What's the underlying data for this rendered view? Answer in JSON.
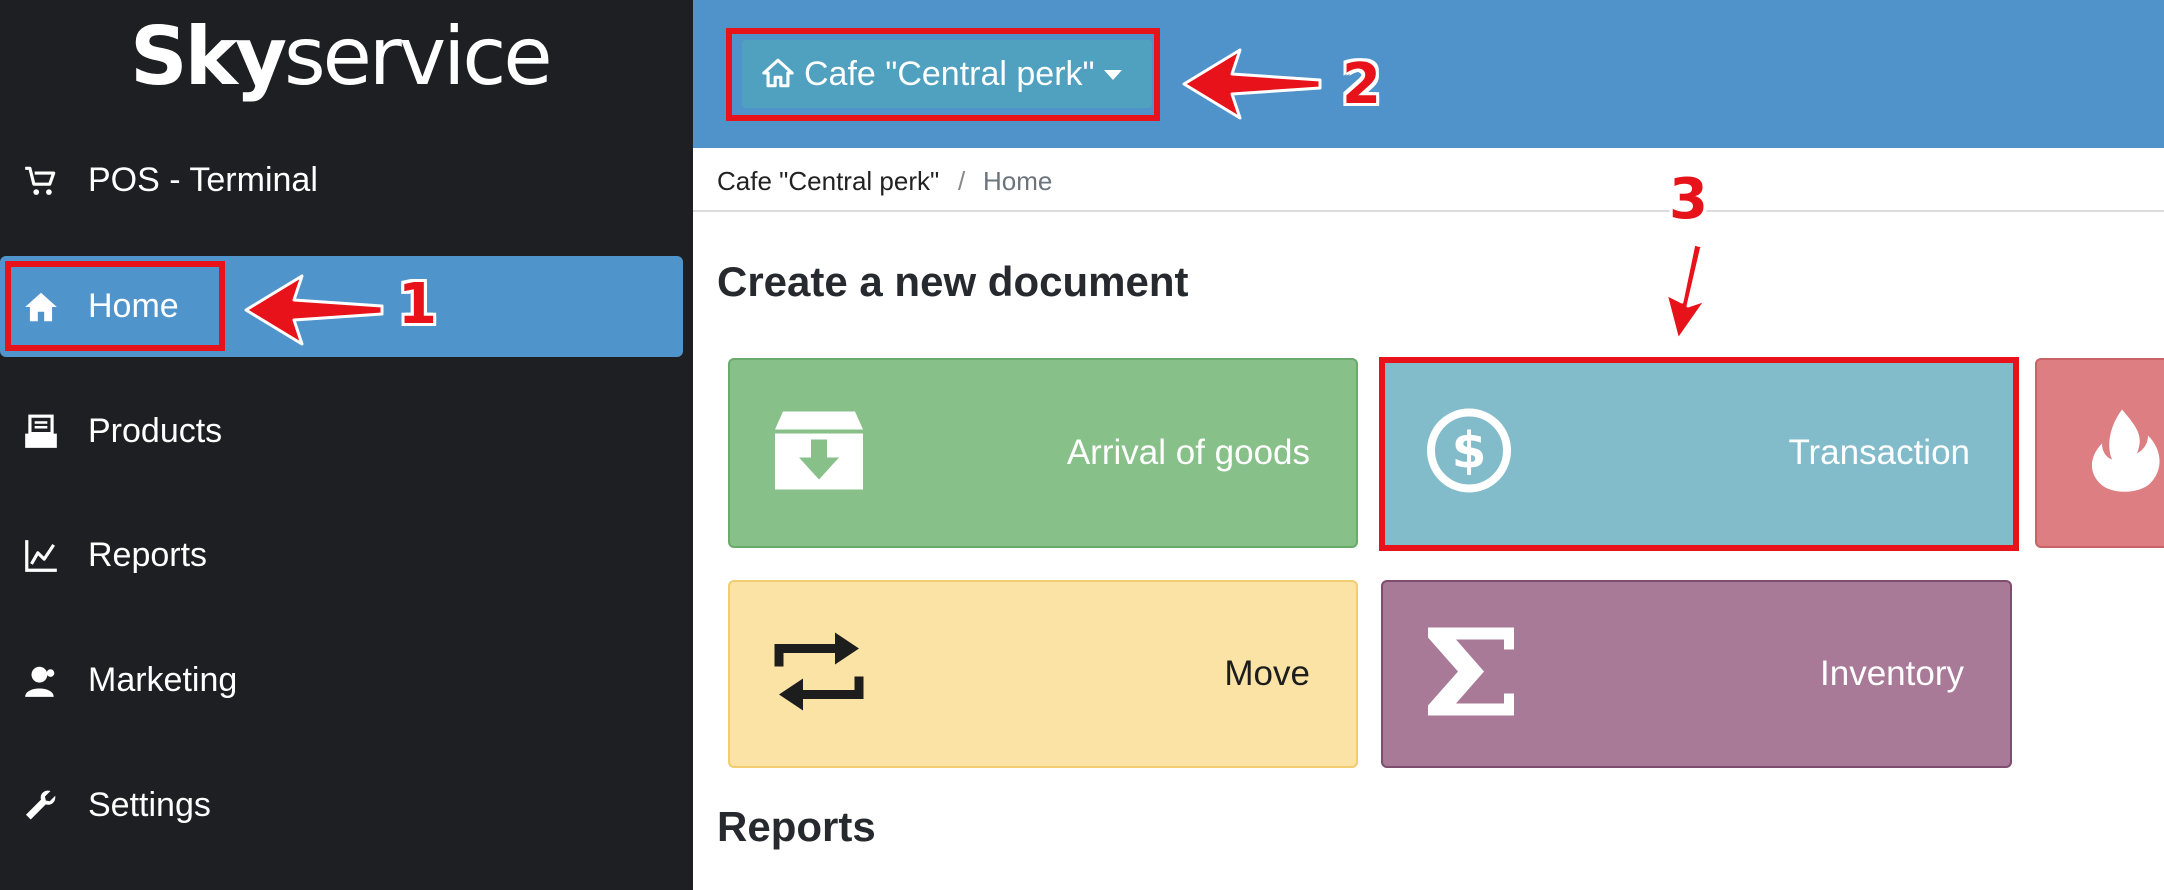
{
  "sidebar": {
    "logo": {
      "bold": "Sky",
      "light": "service"
    },
    "items": [
      {
        "label": "POS - Terminal",
        "icon": "cart-icon"
      },
      {
        "label": "Home",
        "icon": "home-icon",
        "active": true
      },
      {
        "label": "Products",
        "icon": "products-icon"
      },
      {
        "label": "Reports",
        "icon": "chart-icon"
      },
      {
        "label": "Marketing",
        "icon": "user-icon"
      },
      {
        "label": "Settings",
        "icon": "wrench-icon"
      }
    ]
  },
  "header": {
    "store_selector": {
      "label": "Cafe \"Central perk\"",
      "icon": "home-icon"
    }
  },
  "breadcrumb": {
    "items": [
      "Cafe \"Central perk\"",
      "Home"
    ],
    "separator": "/"
  },
  "main": {
    "create_title": "Create a new document",
    "tiles": [
      {
        "label": "Arrival of goods",
        "icon": "archive-download-icon",
        "color": "#87c088"
      },
      {
        "label": "Transaction",
        "icon": "dollar-circle-icon",
        "color": "#82bccb"
      },
      {
        "label": "",
        "icon": "fire-icon",
        "color": "#dd7f82"
      },
      {
        "label": "Move",
        "icon": "exchange-icon",
        "color": "#fae3a4"
      },
      {
        "label": "Inventory",
        "icon": "sigma-icon",
        "color": "#a87a97"
      }
    ],
    "reports_title": "Reports"
  },
  "annotations": {
    "numbers": [
      "1",
      "2",
      "3"
    ],
    "color": "#e8121a"
  },
  "colors": {
    "sidebar_bg": "#1d1f23",
    "active_item": "#5094cc",
    "header_bg": "#5093ca",
    "store_btn": "#4fa1bf"
  }
}
